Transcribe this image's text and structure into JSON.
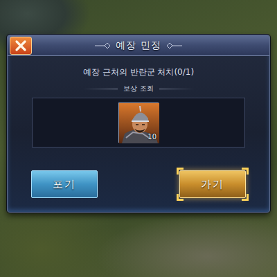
{
  "dialog": {
    "title": "예장 민정"
  },
  "quest": {
    "objective": "예장 근처의 반란군 처치(0/1)"
  },
  "rewards": {
    "heading": "보상 조회",
    "items": [
      {
        "count": "10"
      }
    ]
  },
  "buttons": [
    {
      "label": "포기",
      "kind": "cancel",
      "selected": false
    },
    {
      "label": "가기",
      "kind": "confirm",
      "selected": true
    }
  ]
}
